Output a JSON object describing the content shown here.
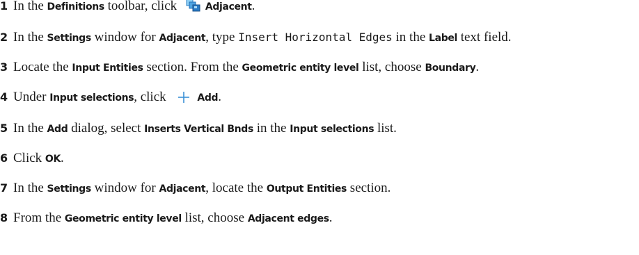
{
  "steps": [
    {
      "num": "1",
      "t1": "In the ",
      "b1": "Definitions",
      "t2": " toolbar, click ",
      "icon": "adjacent-icon",
      "b2": "Adjacent",
      "t3": "."
    },
    {
      "num": "2",
      "t1": "In the ",
      "b1": "Settings",
      "t2": " window for ",
      "b2": "Adjacent",
      "t3": ", type ",
      "m1": "Insert Horizontal Edges",
      "t4": " in the ",
      "b3": "Label",
      "t5": " text field."
    },
    {
      "num": "3",
      "t1": "Locate the ",
      "b1": "Input Entities",
      "t2": " section. From the ",
      "b2": "Geometric entity level",
      "t3": " list, choose ",
      "b3": "Boundary",
      "t4": "."
    },
    {
      "num": "4",
      "t1": "Under ",
      "b1": "Input selections",
      "t2": ", click ",
      "icon": "plus-icon",
      "b2": "Add",
      "t3": "."
    },
    {
      "num": "5",
      "t1": "In the ",
      "b1": "Add",
      "t2": " dialog, select ",
      "b2": "Inserts Vertical Bnds",
      "t3": " in the ",
      "b3": "Input selections",
      "t4": " list."
    },
    {
      "num": "6",
      "t1": "Click ",
      "b1": "OK",
      "t2": "."
    },
    {
      "num": "7",
      "t1": "In the ",
      "b1": "Settings",
      "t2": " window for ",
      "b2": "Adjacent",
      "t3": ", locate the ",
      "b3": "Output Entities",
      "t4": " section."
    },
    {
      "num": "8",
      "t1": "From the ",
      "b1": "Geometric entity level",
      "t2": " list, choose ",
      "b2": "Adjacent edges",
      "t3": "."
    }
  ],
  "colors": {
    "text": "#1a1a1a",
    "icon_light": "#7cc3f0",
    "icon_dark": "#1f6fb8",
    "plus": "#3a8fd6"
  }
}
